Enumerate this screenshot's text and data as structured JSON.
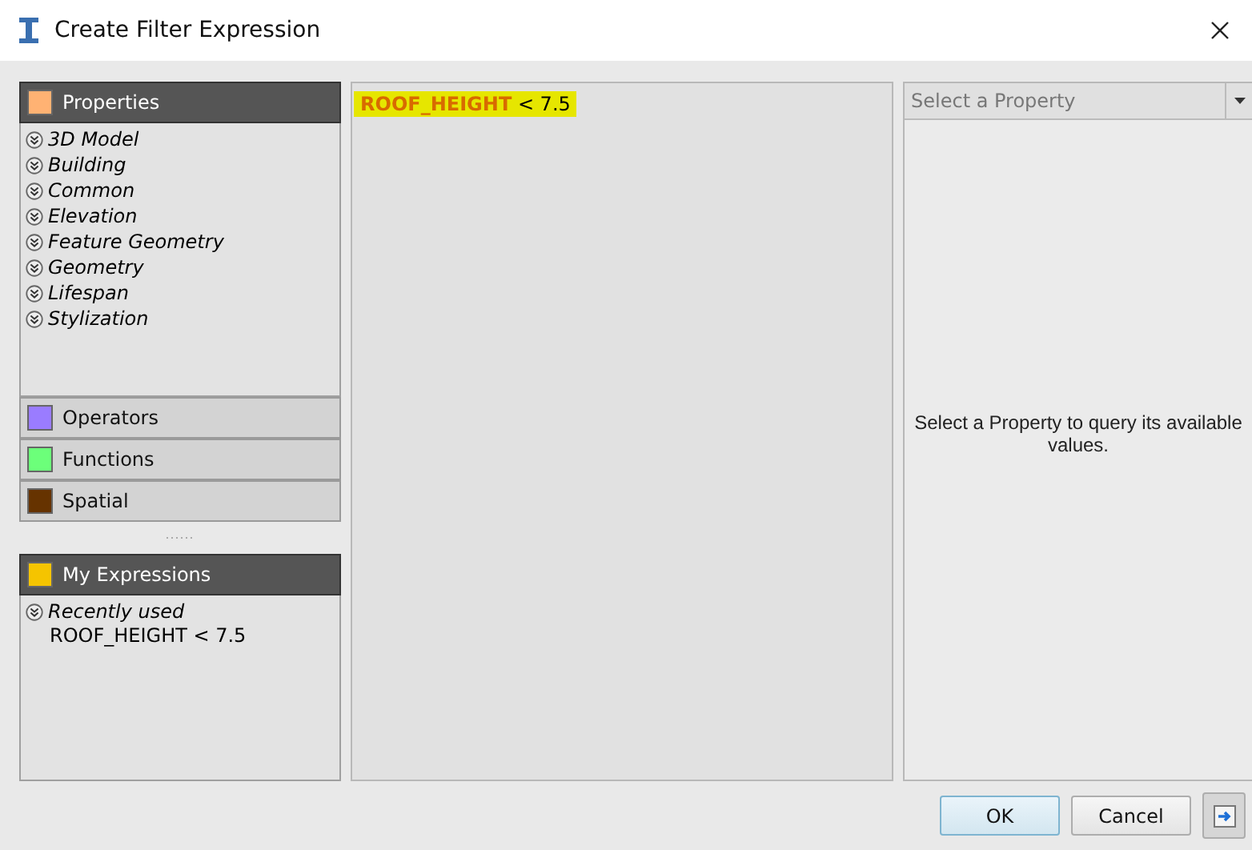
{
  "window": {
    "title": "Create Filter Expression"
  },
  "categories": [
    {
      "label": "Properties",
      "color": "#ffb273",
      "expanded": true,
      "items": [
        {
          "label": "3D Model"
        },
        {
          "label": "Building"
        },
        {
          "label": "Common"
        },
        {
          "label": "Elevation"
        },
        {
          "label": "Feature Geometry"
        },
        {
          "label": "Geometry"
        },
        {
          "label": "Lifespan"
        },
        {
          "label": "Stylization"
        }
      ]
    },
    {
      "label": "Operators",
      "color": "#9a7cff",
      "expanded": false
    },
    {
      "label": "Functions",
      "color": "#6cff7a",
      "expanded": false
    },
    {
      "label": "Spatial",
      "color": "#663300",
      "expanded": false
    }
  ],
  "my_expressions": {
    "label": "My Expressions",
    "color": "#f5c400",
    "expanded": true,
    "groups": [
      {
        "label": "Recently used",
        "entries": [
          "ROOF_HEIGHT < 7.5"
        ]
      }
    ]
  },
  "expression": [
    {
      "kind": "field",
      "text": "ROOF_HEIGHT"
    },
    {
      "kind": "operator",
      "text": "< 7.5"
    }
  ],
  "property_select": {
    "placeholder": "Select a Property"
  },
  "values_hint": "Select a Property to query its available values.",
  "buttons": [
    {
      "kind": "text",
      "label": "OK",
      "default": true
    },
    {
      "kind": "text",
      "label": "Cancel",
      "default": false
    },
    {
      "kind": "arrow"
    }
  ]
}
